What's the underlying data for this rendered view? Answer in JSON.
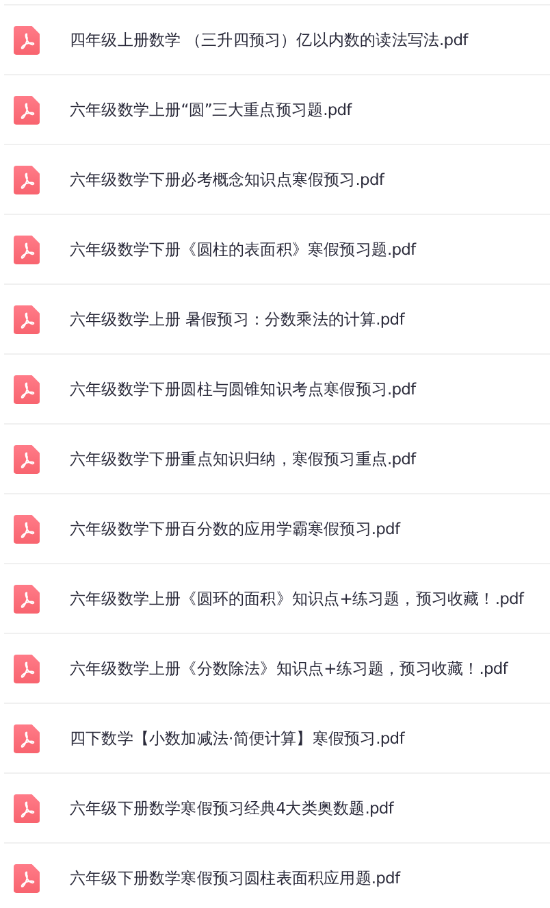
{
  "files": [
    {
      "name": "四年级上册数学 （三升四预习）亿以内数的读法写法.pdf"
    },
    {
      "name": "六年级数学上册“圆”三大重点预习题.pdf"
    },
    {
      "name": "六年级数学下册必考概念知识点寒假预习.pdf"
    },
    {
      "name": "六年级数学下册《圆柱的表面积》寒假预习题.pdf"
    },
    {
      "name": "六年级数学上册 暑假预习：分数乘法的计算.pdf"
    },
    {
      "name": "六年级数学下册圆柱与圆锥知识考点寒假预习.pdf"
    },
    {
      "name": "六年级数学下册重点知识归纳，寒假预习重点.pdf"
    },
    {
      "name": "六年级数学下册百分数的应用学霸寒假预习.pdf"
    },
    {
      "name": "六年级数学上册《圆环的面积》知识点+练习题，预习收藏！.pdf"
    },
    {
      "name": "六年级数学上册《分数除法》知识点+练习题，预习收藏！.pdf"
    },
    {
      "name": "四下数学【小数加减法·简便计算】寒假预习.pdf"
    },
    {
      "name": "六年级下册数学寒假预习经典4大类奥数题.pdf"
    },
    {
      "name": "六年级下册数学寒假预习圆柱表面积应用题.pdf"
    }
  ]
}
